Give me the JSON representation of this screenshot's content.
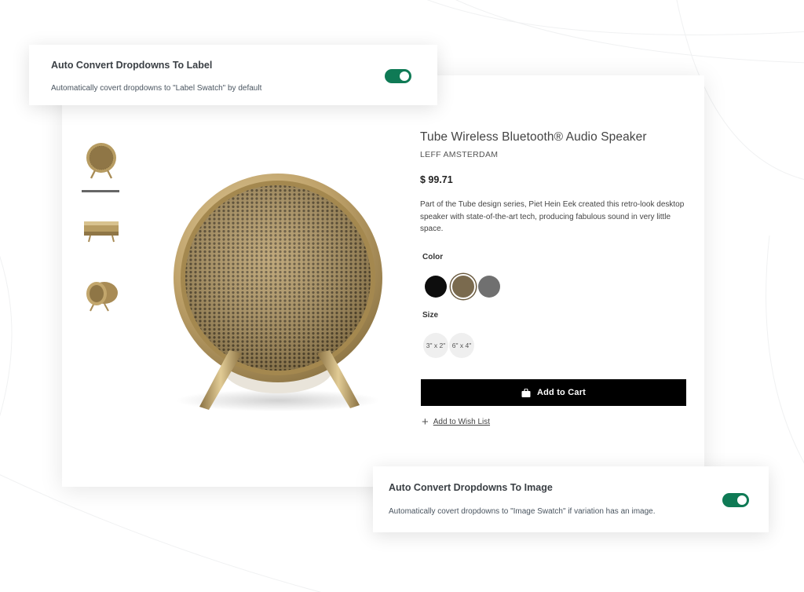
{
  "settings": {
    "label_convert": {
      "title": "Auto Convert Dropdowns To Label",
      "description": "Automatically covert dropdowns to \"Label Swatch\" by default",
      "enabled": true
    },
    "image_convert": {
      "title": "Auto Convert Dropdowns To Image",
      "description": "Automatically covert dropdowns to \"Image Swatch\" if variation has an image.",
      "enabled": true
    },
    "toggle_color": "#0f7a55"
  },
  "product": {
    "title": "Tube Wireless Bluetooth® Audio Speaker",
    "brand": "LEFF AMSTERDAM",
    "price": "$ 99.71",
    "description": "Part of the Tube design series, Piet Hein Eek created this retro-look desktop speaker with state-of-the-art tech, producing fabulous sound in very little space.",
    "thumbnails": [
      "speaker-front",
      "speaker-side",
      "speaker-angle"
    ],
    "selected_thumbnail": 0,
    "color_label": "Color",
    "colors": [
      "#0d0d0d",
      "#7a6a4e",
      "#707070"
    ],
    "selected_color": 1,
    "size_label": "Size",
    "sizes": [
      "3\" x 2\"",
      "6\" x 4\""
    ],
    "add_to_cart": "Add to Cart",
    "wishlist": "Add to Wish List"
  }
}
